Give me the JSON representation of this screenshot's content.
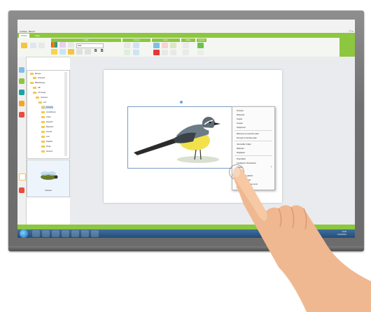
{
  "window": {
    "title": "Untitled - iBoard",
    "controls": "–  ❐  ✕"
  },
  "file_tabs": [
    "Fichier",
    "Page"
  ],
  "ribbon_groups": [
    "Outils",
    "Format",
    "Zoom",
    "Effets",
    "Formes",
    "Enregistrer"
  ],
  "font_box": "Arial",
  "tree": {
    "rows": [
      "Bureau",
      "ptrasend",
      "Bibliothèque",
      "AB",
      "Cd Image",
      "Animaux",
      "Acc",
      "Animaux",
      "Amphibiens",
      "Chien",
      "Dauphin",
      "Éléphant",
      "Insecte",
      "Lion",
      "Papillon",
      "Singe",
      "Serpent"
    ]
  },
  "preview": {
    "label": "Insectes"
  },
  "context_menu": {
    "items": [
      "Grouper",
      "Dissocier",
      "Copier",
      "Couper",
      "Supprimer",
      "Ramener au premier plan",
      "Envoyer à l'arrière-plan",
      "Verrouiller l'objet",
      "Masquer",
      "Dupliquer",
      "Propriétés",
      "Configurer l'interaction",
      "Aligner",
      "Ajouter à la galerie",
      "Exporter l'image",
      "Enregistrer l'image sous",
      "Restaurer"
    ]
  },
  "taskbar": {
    "tray_text": "FR",
    "time": "11:06",
    "date": "11/21/2013"
  },
  "colors": {
    "accent_green": "#8dc63f",
    "taskbar_blue": "#2d5d8c",
    "bezel_gray": "#777777"
  }
}
